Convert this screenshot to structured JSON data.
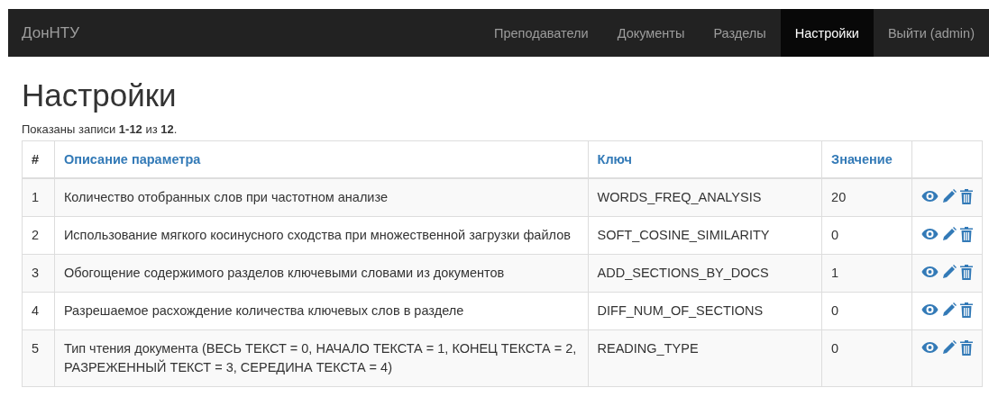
{
  "navbar": {
    "brand": "ДонНТУ",
    "items": [
      {
        "label": "Преподаватели",
        "selected": false
      },
      {
        "label": "Документы",
        "selected": false
      },
      {
        "label": "Разделы",
        "selected": false
      },
      {
        "label": "Настройки",
        "selected": true
      },
      {
        "label": "Выйти (admin)",
        "selected": false
      }
    ]
  },
  "title": "Настройки",
  "summary": "Показаны записи **1-12** из **12**.",
  "table": {
    "columns": [
      "#",
      "Описание параметра",
      "Ключ",
      "Значение"
    ],
    "rows": [
      {
        "number": "1",
        "description": "Количество отобранных слов при частотном анализе",
        "key": "WORDS_FREQ_ANALYSIS",
        "value": "20"
      },
      {
        "number": "2",
        "description": "Использование мягкого косинусного сходства при множественной загрузки файлов",
        "key": "SOFT_COSINE_SIMILARITY",
        "value": "0"
      },
      {
        "number": "3",
        "description": "Обогощение содержимого разделов ключевыми словами из документов",
        "key": "ADD_SECTIONS_BY_DOCS",
        "value": "1"
      },
      {
        "number": "4",
        "description": "Разрешаемое расхождение количества ключевых слов в разделе",
        "key": "DIFF_NUM_OF_SECTIONS",
        "value": "0"
      },
      {
        "number": "5",
        "description": "Тип чтения документа (ВЕСЬ ТЕКСТ = 0, НАЧАЛО ТЕКСТА = 1, КОНЕЦ ТЕКСТА = 2, РАЗРЕЖЕННЫЙ ТЕКСТ = 3, СЕРЕДИНА ТЕКСТА = 4)",
        "key": "READING_TYPE",
        "value": "0"
      }
    ]
  }
}
